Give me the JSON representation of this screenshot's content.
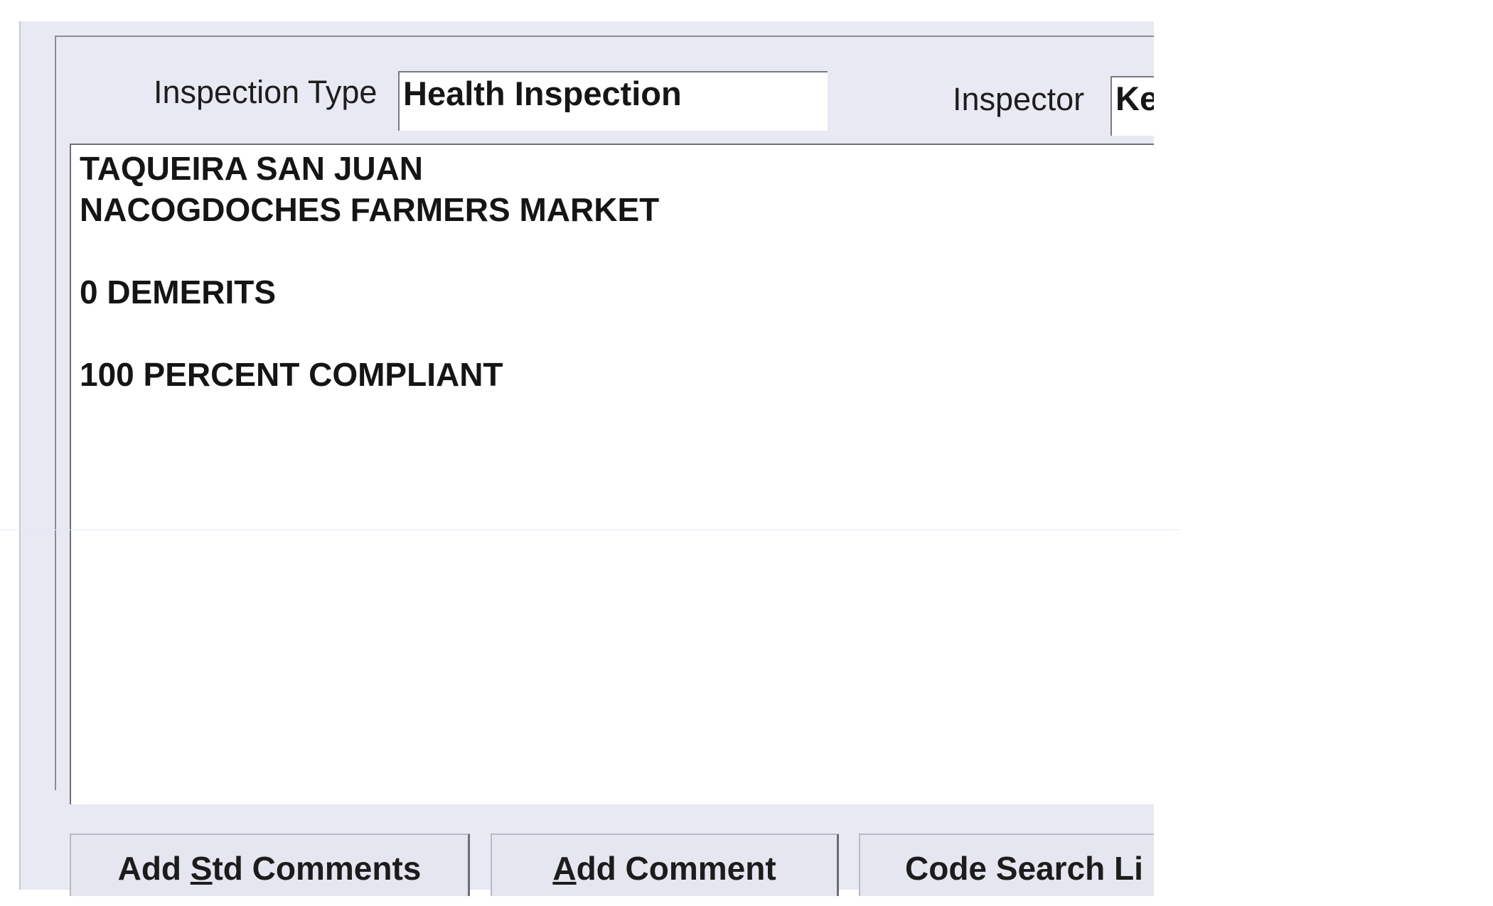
{
  "form": {
    "inspection_type_label": "Inspection Type",
    "inspection_type_value": "Health Inspection",
    "inspector_label": "Inspector",
    "inspector_value": "Ke"
  },
  "comments": {
    "lines": [
      "TAQUEIRA SAN JUAN",
      "NACOGDOCHES FARMERS MARKET",
      "",
      "0 DEMERITS",
      "",
      "100 PERCENT COMPLIANT"
    ]
  },
  "buttons": {
    "add_std_comments": {
      "pre": "Add ",
      "key": "S",
      "post": "td Comments"
    },
    "add_comment": {
      "pre": "",
      "key": "A",
      "post": "dd Comment"
    },
    "code_search": {
      "label": "Code Search Li"
    }
  },
  "colors": {
    "window_bg": "#e9e9f3",
    "field_bg": "#ffffff",
    "text": "#161616"
  }
}
